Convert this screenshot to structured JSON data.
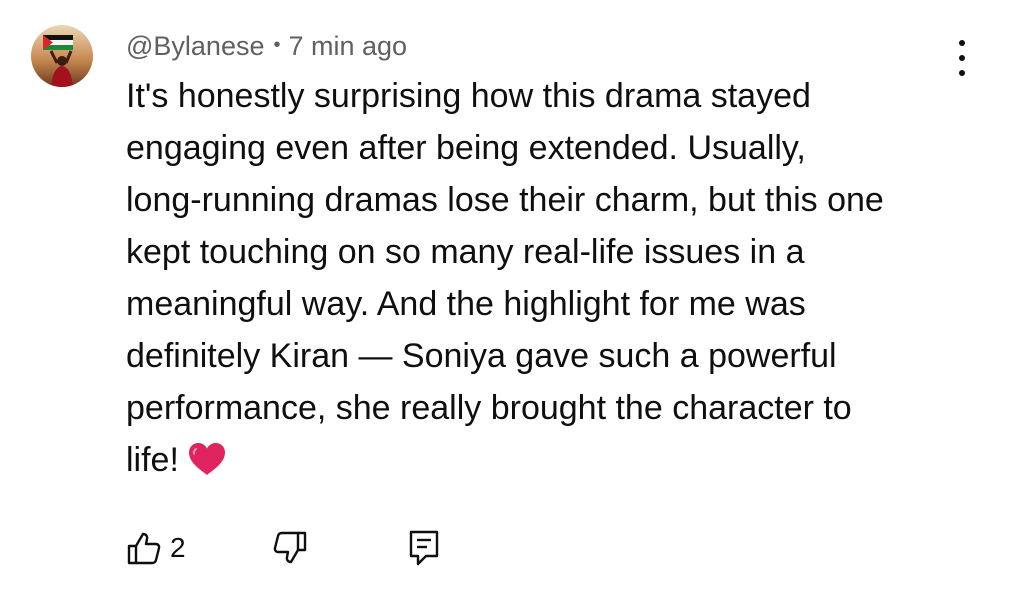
{
  "comment": {
    "author": "@Bylanese",
    "separator": "•",
    "timestamp": "7 min ago",
    "lines": [
      "It's honestly surprising how this drama stayed",
      "engaging even after being extended. Usually,",
      "long-running dramas lose their charm, but this one",
      "kept touching on so many real-life issues in a",
      "meaningful way. And the highlight for me was",
      "definitely Kiran — Soniya gave such a powerful",
      "performance, she really brought the character to",
      "life!"
    ],
    "emoji": "red-heart-icon"
  },
  "actions": {
    "like_icon": "thumbs-up-icon",
    "like_count": "2",
    "dislike_icon": "thumbs-down-icon",
    "reply_icon": "reply-comment-icon"
  },
  "menu": {
    "icon": "more-vertical-icon"
  },
  "colors": {
    "text": "#0f0f0f",
    "secondary": "#606060",
    "heart": "#e0245e",
    "background": "#ffffff"
  }
}
